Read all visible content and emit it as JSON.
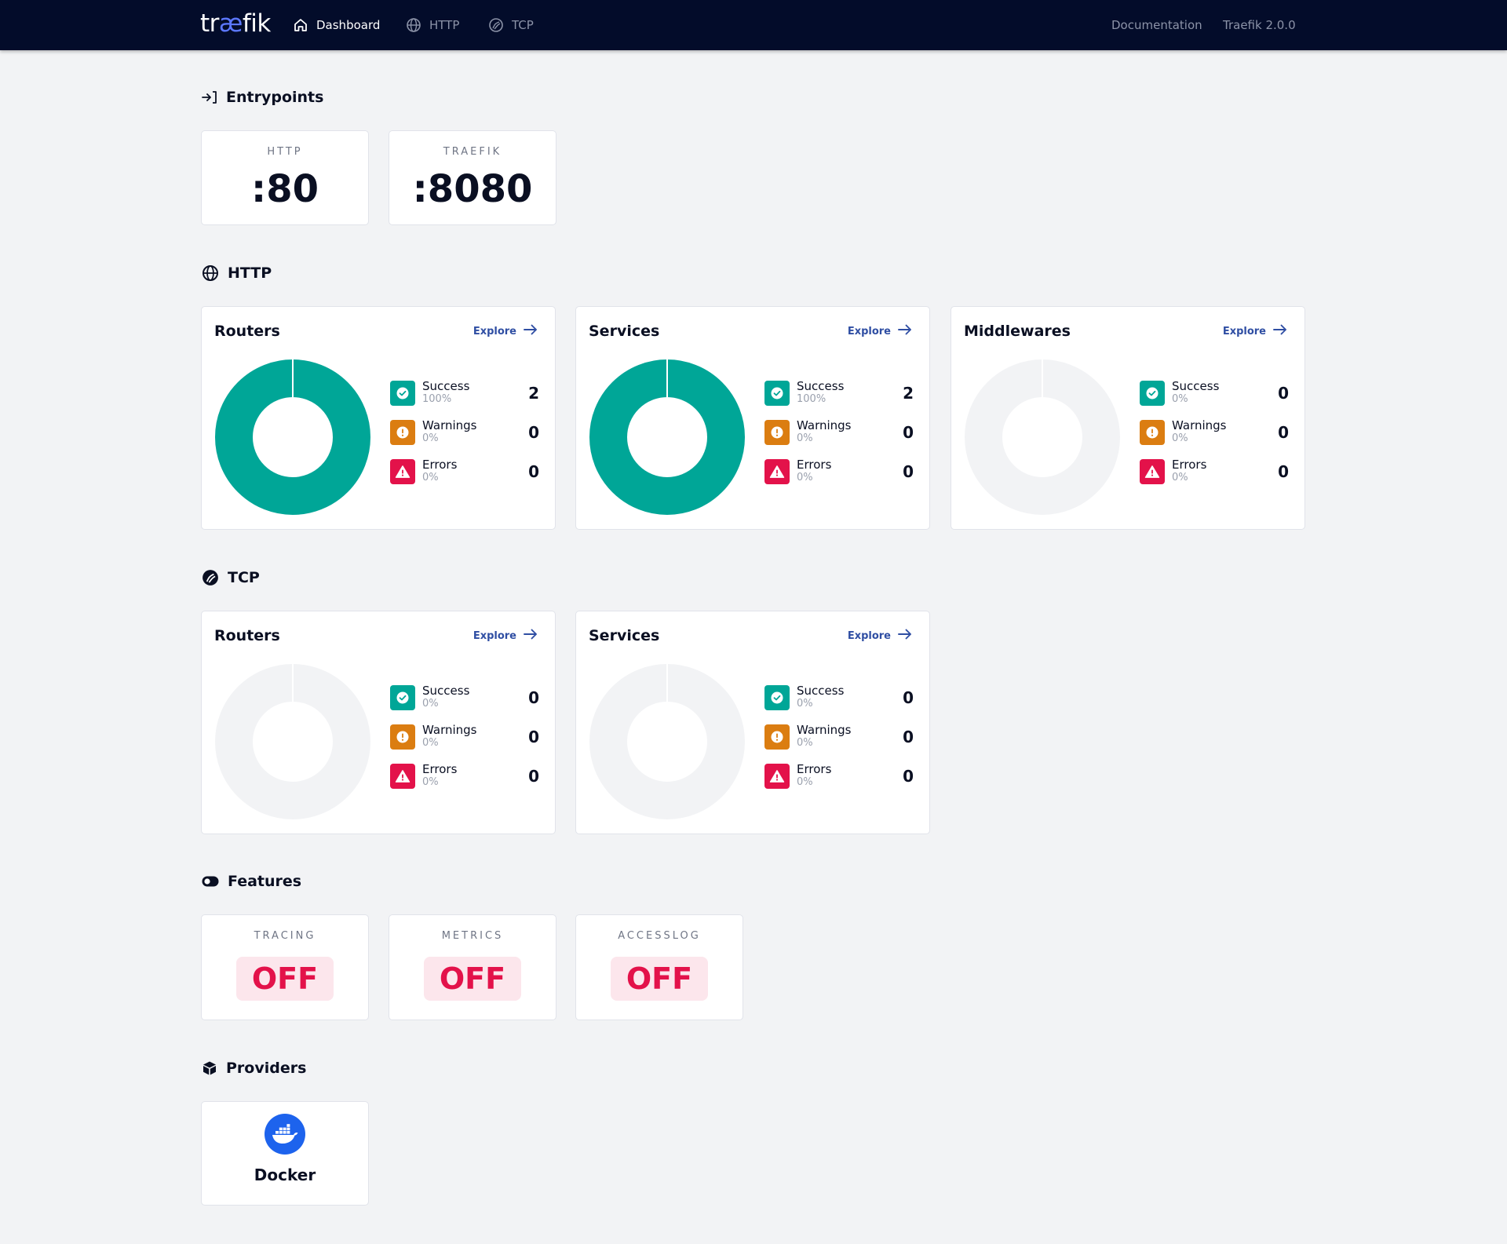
{
  "header": {
    "logo_pre": "tr",
    "logo_ae": "æ",
    "logo_post": "fik",
    "nav": {
      "dashboard": "Dashboard",
      "http": "HTTP",
      "tcp": "TCP"
    },
    "documentation": "Documentation",
    "version": "Traefik 2.0.0"
  },
  "entrypoints": {
    "title": "Entrypoints",
    "items": [
      {
        "label": "HTTP",
        "value": ":80"
      },
      {
        "label": "TRAEFIK",
        "value": ":8080"
      }
    ]
  },
  "http": {
    "title": "HTTP",
    "explore_label": "Explore",
    "cards": [
      {
        "title": "Routers",
        "success": {
          "label": "Success",
          "pct": "100%",
          "count": "2"
        },
        "warnings": {
          "label": "Warnings",
          "pct": "0%",
          "count": "0"
        },
        "errors": {
          "label": "Errors",
          "pct": "0%",
          "count": "0"
        },
        "success_fraction": 1.0
      },
      {
        "title": "Services",
        "success": {
          "label": "Success",
          "pct": "100%",
          "count": "2"
        },
        "warnings": {
          "label": "Warnings",
          "pct": "0%",
          "count": "0"
        },
        "errors": {
          "label": "Errors",
          "pct": "0%",
          "count": "0"
        },
        "success_fraction": 1.0
      },
      {
        "title": "Middlewares",
        "success": {
          "label": "Success",
          "pct": "0%",
          "count": "0"
        },
        "warnings": {
          "label": "Warnings",
          "pct": "0%",
          "count": "0"
        },
        "errors": {
          "label": "Errors",
          "pct": "0%",
          "count": "0"
        },
        "success_fraction": 0.0
      }
    ]
  },
  "tcp": {
    "title": "TCP",
    "explore_label": "Explore",
    "cards": [
      {
        "title": "Routers",
        "success": {
          "label": "Success",
          "pct": "0%",
          "count": "0"
        },
        "warnings": {
          "label": "Warnings",
          "pct": "0%",
          "count": "0"
        },
        "errors": {
          "label": "Errors",
          "pct": "0%",
          "count": "0"
        },
        "success_fraction": 0.0
      },
      {
        "title": "Services",
        "success": {
          "label": "Success",
          "pct": "0%",
          "count": "0"
        },
        "warnings": {
          "label": "Warnings",
          "pct": "0%",
          "count": "0"
        },
        "errors": {
          "label": "Errors",
          "pct": "0%",
          "count": "0"
        },
        "success_fraction": 0.0
      }
    ]
  },
  "features": {
    "title": "Features",
    "items": [
      {
        "label": "TRACING",
        "value": "OFF"
      },
      {
        "label": "METRICS",
        "value": "OFF"
      },
      {
        "label": "ACCESSLOG",
        "value": "OFF"
      }
    ]
  },
  "providers": {
    "title": "Providers",
    "items": [
      {
        "name": "Docker",
        "icon": "docker-icon"
      }
    ]
  },
  "colors": {
    "topbar": "#030c2a",
    "success": "#00a697",
    "warning": "#db7d11",
    "error": "#e3124a",
    "link": "#2f4ea3",
    "empty_donut": "#f2f3f5",
    "docker": "#1d63ed"
  }
}
